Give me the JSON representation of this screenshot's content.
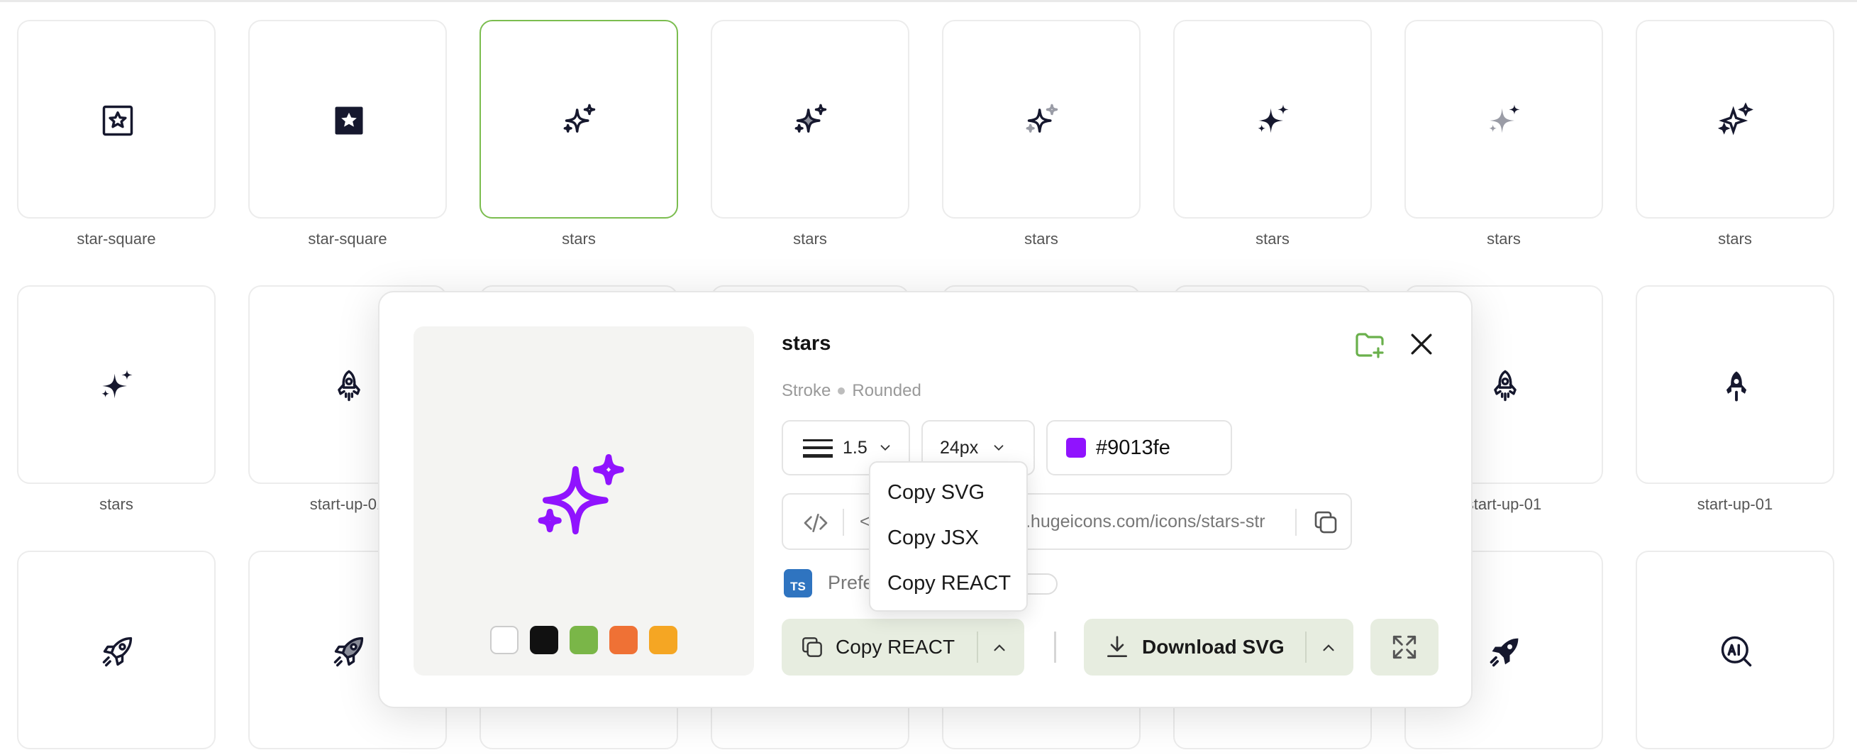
{
  "icon_grid": [
    {
      "label": "star-square",
      "icon": "star-square-outline-icon"
    },
    {
      "label": "star-square",
      "icon": "star-square-solid-icon"
    },
    {
      "label": "stars",
      "icon": "stars-stroke-icon",
      "selected": true
    },
    {
      "label": "stars",
      "icon": "stars-duotone-icon"
    },
    {
      "label": "stars",
      "icon": "stars-twotone-icon"
    },
    {
      "label": "stars",
      "icon": "stars-solid-icon"
    },
    {
      "label": "stars",
      "icon": "stars-bulk-icon"
    },
    {
      "label": "stars",
      "icon": "stars-sharp-icon"
    },
    {
      "label": "stars",
      "icon": "stars-solid-icon"
    },
    {
      "label": "start-up-01",
      "icon": "rocket-outline-icon"
    },
    {
      "label": "",
      "icon": ""
    },
    {
      "label": "",
      "icon": ""
    },
    {
      "label": "",
      "icon": ""
    },
    {
      "label": "",
      "icon": ""
    },
    {
      "label": "start-up-01",
      "icon": "rocket-outline-icon"
    },
    {
      "label": "start-up-01",
      "icon": "rocket-solid-icon"
    },
    {
      "label": "",
      "icon": "rocket-launch-icon"
    },
    {
      "label": "",
      "icon": "rocket-launch-duotone-icon"
    },
    {
      "label": "",
      "icon": ""
    },
    {
      "label": "",
      "icon": ""
    },
    {
      "label": "",
      "icon": ""
    },
    {
      "label": "",
      "icon": ""
    },
    {
      "label": "",
      "icon": "rocket-launch-solid-icon"
    },
    {
      "label": "",
      "icon": "ai-search-icon"
    }
  ],
  "modal": {
    "title": "stars",
    "style_label": "Stroke",
    "variant_label": "Rounded",
    "stroke_width": "1.5",
    "size": "24px",
    "color": "#9013fe",
    "embed_text": "<img src=\"https://cdn.hugeicons.com/icons/stars-str",
    "ts_badge": "TS",
    "preference_text": "Prefe",
    "copy_button_label": "Copy REACT",
    "download_button_label": "Download SVG",
    "swatches": [
      "#ffffff",
      "#111111",
      "#7ab648",
      "#ef7135",
      "#f5a623"
    ]
  },
  "copy_menu": {
    "items": [
      "Copy SVG",
      "Copy JSX",
      "Copy REACT"
    ]
  },
  "colors": {
    "accent_green": "#6ab04c",
    "icon_dark": "#16182e",
    "button_bg": "#e7ede0"
  }
}
